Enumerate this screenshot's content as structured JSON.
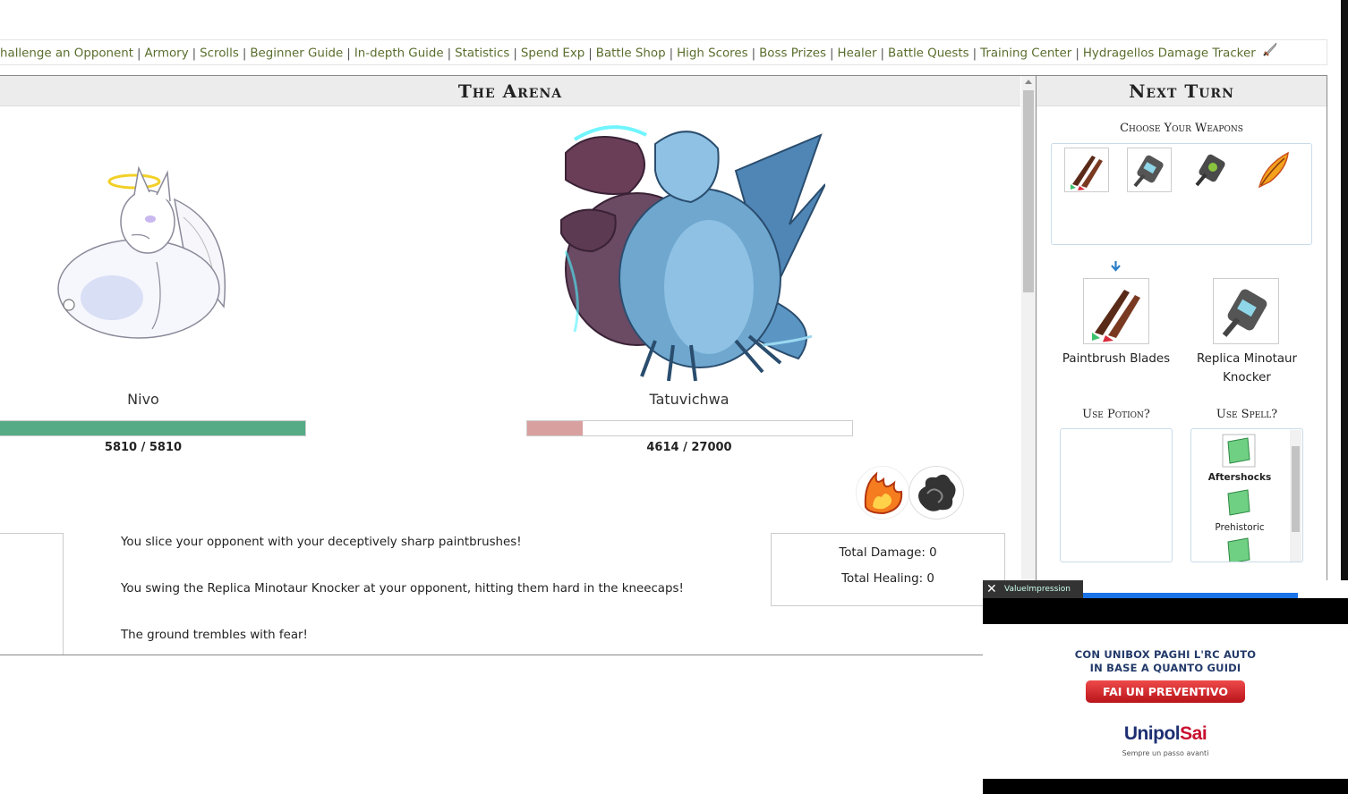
{
  "nav": {
    "links": [
      "hallenge an Opponent",
      "Armory",
      "Scrolls",
      "Beginner Guide",
      "In-depth Guide",
      "Statistics",
      "Spend Exp",
      "Battle Shop",
      "High Scores",
      "Boss Prizes",
      "Healer",
      "Battle Quests",
      "Training Center",
      "Hydragellos Damage Tracker"
    ]
  },
  "arena": {
    "title": "The Arena",
    "player": {
      "name": "Nivo",
      "hp_text": "5810 / 5810",
      "hp_fraction": 1.0,
      "bar_color": "#55ab86"
    },
    "opponent": {
      "name": "Tatuvichwa",
      "hp_text": "4614 / 27000",
      "hp_fraction": 0.171,
      "bar_color": "#d9a0a0"
    },
    "log": [
      "You slice your opponent with your deceptively sharp paintbrushes!",
      "You swing the Replica Minotaur Knocker at your opponent, hitting them hard in the kneecaps!",
      "The ground trembles with fear!"
    ],
    "totals": {
      "damage": "Total Damage: 0",
      "healing": "Total Healing: 0"
    }
  },
  "next_turn": {
    "title": "Next Turn",
    "choose_label": "Choose Your Weapons",
    "weapons": [
      {
        "icon": "paintbrush-blades-icon",
        "selected": true
      },
      {
        "icon": "minotaur-knocker-icon",
        "selected": true
      },
      {
        "icon": "dark-knocker-icon",
        "selected": false
      },
      {
        "icon": "flame-feather-icon",
        "selected": false
      }
    ],
    "chosen": [
      "Paintbrush Blades",
      "Replica Minotaur Knocker"
    ],
    "potion_label": "Use Potion?",
    "spell_label": "Use Spell?",
    "spells": [
      "Aftershocks",
      "Prehistoric"
    ]
  },
  "ad": {
    "network": "ValueImpression",
    "headline_1": "CON UNIBOX PAGHI L'RC AUTO",
    "headline_2": "IN BASE A QUANTO GUIDI",
    "cta": "FAI UN PREVENTIVO",
    "brand_a": "Unipol",
    "brand_b": "Sai",
    "tagline": "Sempre un passo avanti"
  }
}
